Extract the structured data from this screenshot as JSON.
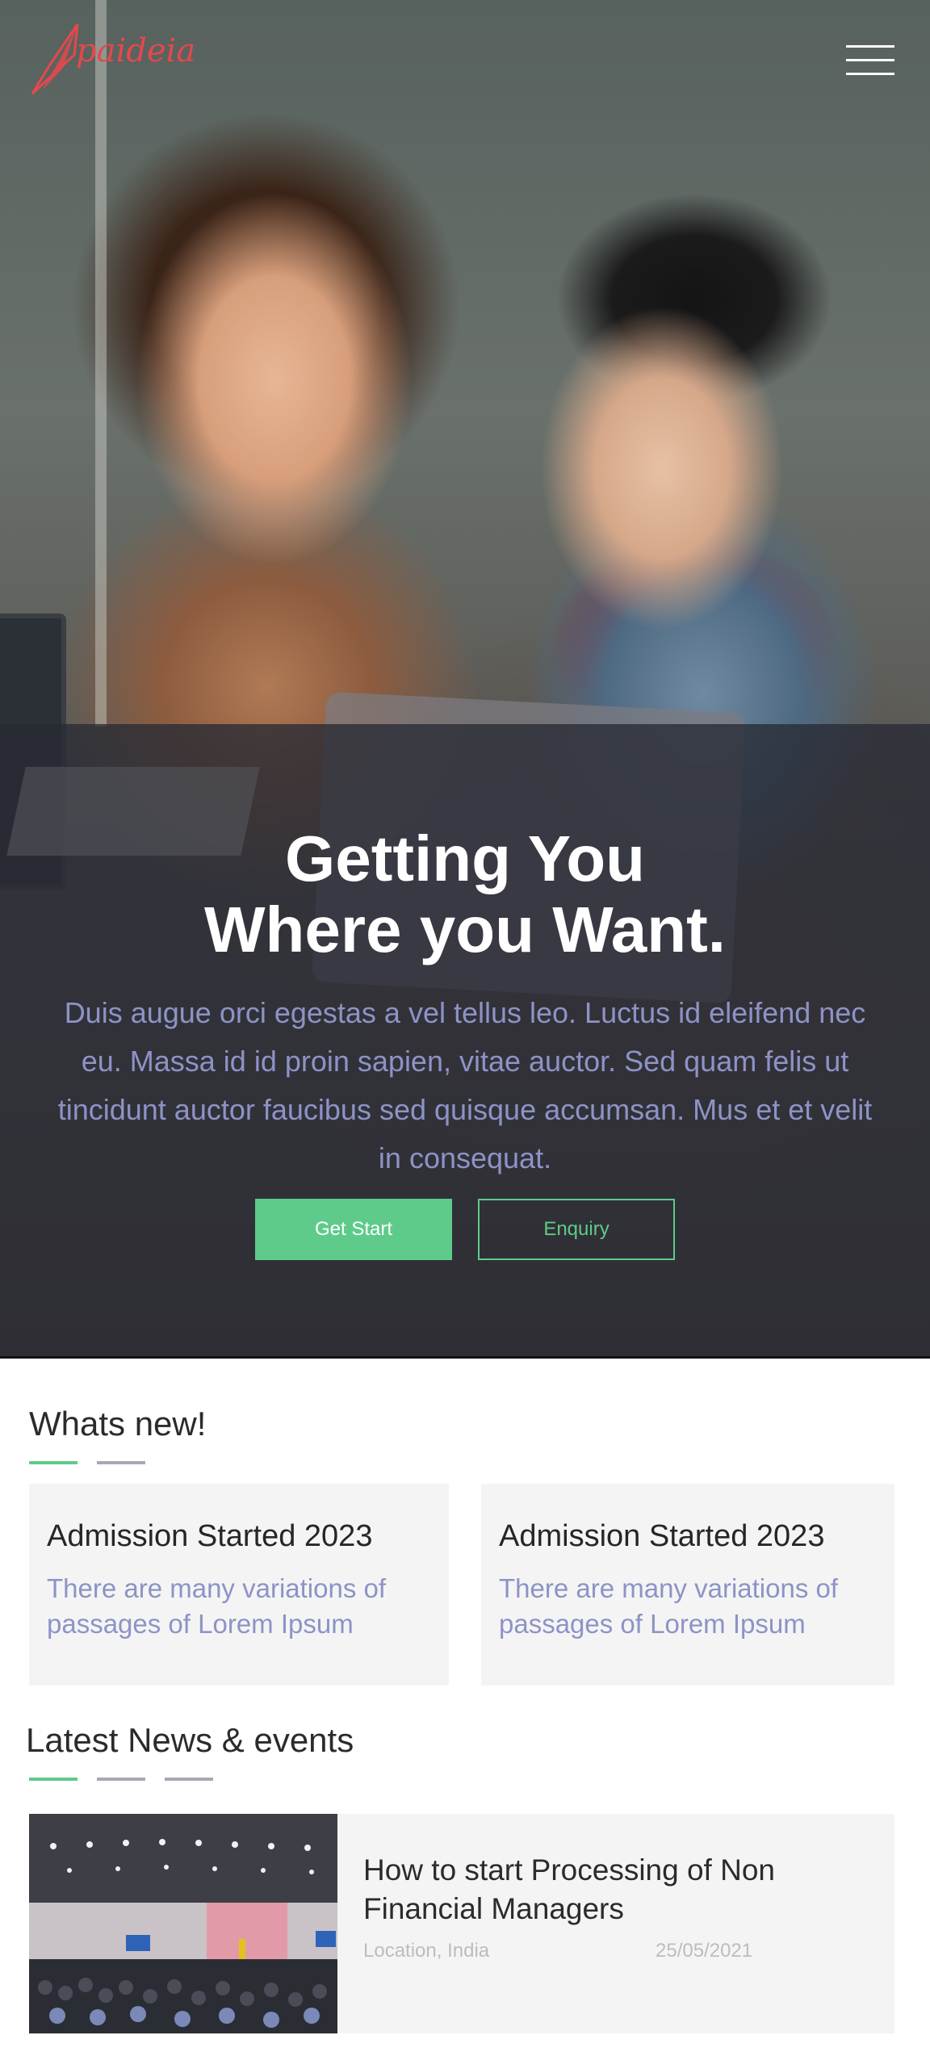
{
  "brand": {
    "name": "paideia",
    "accent": "#e5484d"
  },
  "nav": {
    "menu_icon": "hamburger-menu-icon"
  },
  "hero": {
    "title_line1": "Getting You",
    "title_line2": "Where you Want.",
    "description": "Duis augue orci egestas a vel tellus leo. Luctus id eleifend nec eu. Massa id id proin sapien, vitae auctor. Sed quam felis ut tincidunt auctor faucibus sed quisque accumsan. Mus et et velit in consequat.",
    "primary_button": "Get Start",
    "secondary_button": "Enquiry",
    "button_color": "#5ecb8a",
    "text_color": "#8d93c6"
  },
  "whats_new": {
    "title": "Whats new!",
    "cards": [
      {
        "title": "Admission Started 2023",
        "text": "There are many variations of passages of Lorem Ipsum"
      },
      {
        "title": "Admission Started 2023",
        "text": "There are many variations of passages of Lorem Ipsum"
      }
    ]
  },
  "news": {
    "title": "Latest News & events",
    "items": [
      {
        "title": "How to start Processing of Non Financial Managers",
        "location": "Location, India",
        "date": "25/05/2021"
      }
    ]
  }
}
